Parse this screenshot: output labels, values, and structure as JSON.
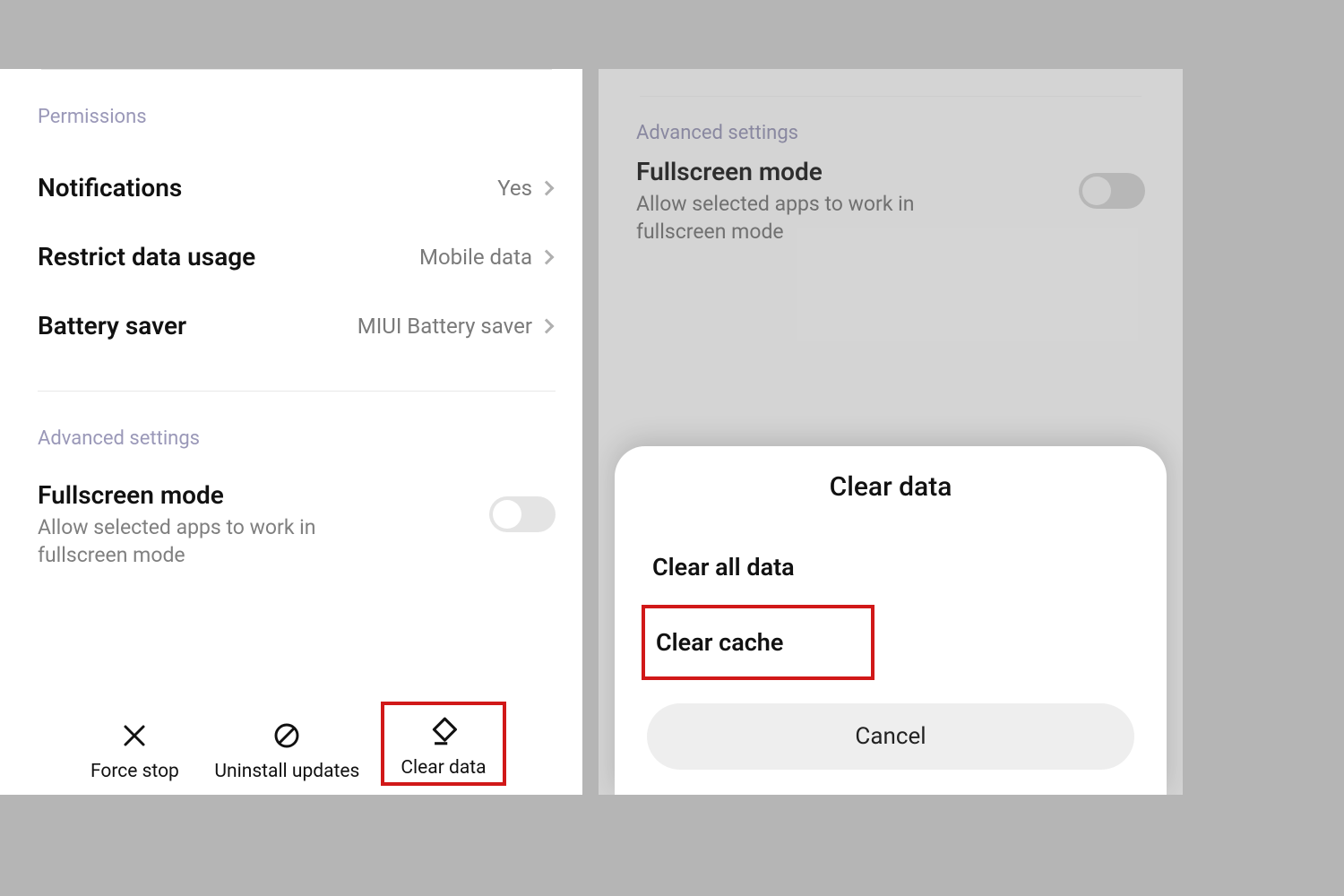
{
  "left": {
    "permissions_label": "Permissions",
    "notifications": {
      "title": "Notifications",
      "value": "Yes"
    },
    "restrict": {
      "title": "Restrict data usage",
      "value": "Mobile data"
    },
    "battery": {
      "title": "Battery saver",
      "value": "MIUI Battery saver"
    },
    "advanced_label": "Advanced settings",
    "fullscreen": {
      "title": "Fullscreen mode",
      "desc": "Allow selected apps to work in fullscreen mode",
      "enabled": false
    },
    "actions": {
      "force_stop": "Force stop",
      "uninstall": "Uninstall updates",
      "clear_data": "Clear data"
    }
  },
  "right": {
    "advanced_label": "Advanced settings",
    "fullscreen": {
      "title": "Fullscreen mode",
      "desc": "Allow selected apps to work in fullscreen mode",
      "enabled": false
    },
    "sheet": {
      "title": "Clear data",
      "clear_all": "Clear all data",
      "clear_cache": "Clear cache",
      "cancel": "Cancel"
    }
  }
}
